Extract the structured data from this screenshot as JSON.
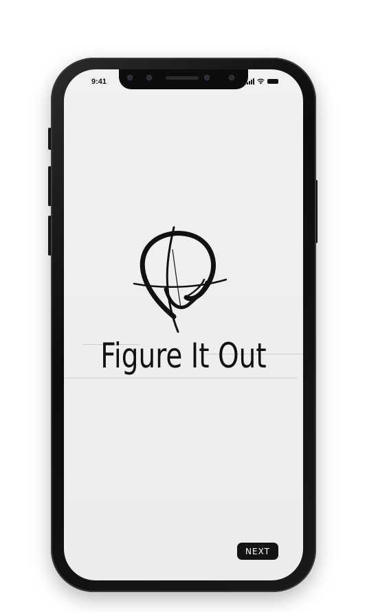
{
  "status_bar": {
    "time": "9:41",
    "icons": [
      "signal-icon",
      "wifi-icon",
      "battery-icon"
    ]
  },
  "app": {
    "title": "Figure It Out",
    "logo_icon": "compass-pin-logo-icon"
  },
  "actions": {
    "next_label": "NEXT"
  },
  "colors": {
    "screen_background": "#efefef",
    "ink": "#111111",
    "button_background": "#141414",
    "button_text": "#ffffff",
    "device_frame": "#141414"
  }
}
